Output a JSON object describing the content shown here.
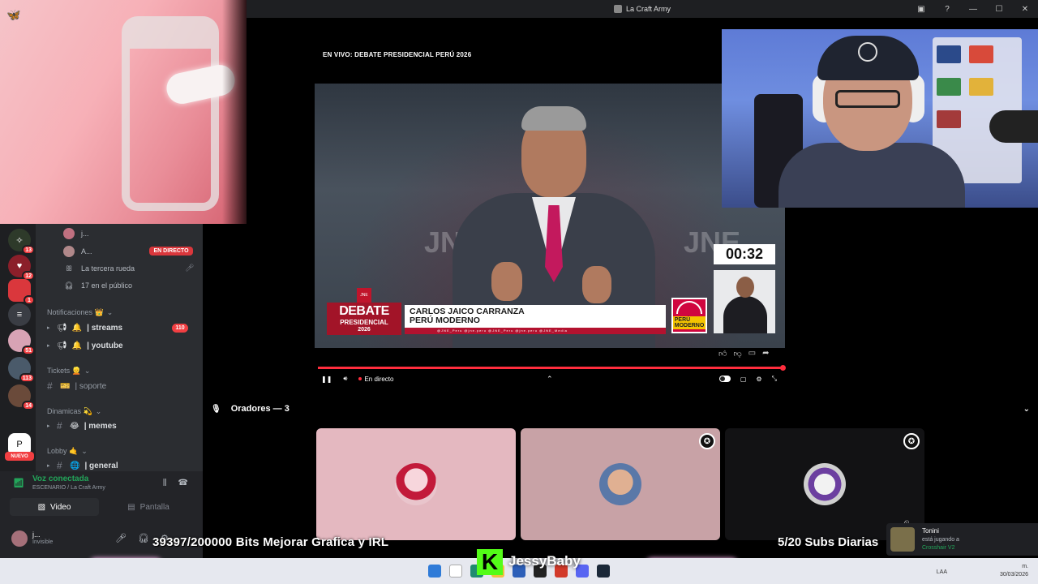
{
  "window": {
    "title": "La Craft Army"
  },
  "broadcast": {
    "title": "EN VIVO: DEBATE PRESIDENCIAL PERÚ 2026",
    "timer": "00:32",
    "watermark_left": "JNE",
    "watermark_right": "JNE",
    "lower_third": {
      "logo_line1": "DEBATE",
      "logo_line2": "PRESIDENCIAL",
      "logo_line3": "2026",
      "jne_badge": "JNE",
      "candidate_name": "CARLOS JAICO CARRANZA",
      "party": "PERÚ MODERNO",
      "party_logo_text": "PERÚ MODERNO",
      "ticker": "@JNE_Peru   @jne.peru   @JNE_Peru   @jne.peru   @JNE_Media"
    },
    "progress_fraction": 1.0,
    "live_label": "En directo"
  },
  "channels": {
    "voice_users": [
      {
        "name": "j..."
      },
      {
        "name": "A..."
      },
      {
        "name": "La tercera rueda"
      },
      {
        "name": "17 en el público"
      }
    ],
    "live_badge": "EN DIRECTO",
    "categories": {
      "notificaciones": "Notificaciones 👑",
      "tickets": "Tickets 👱",
      "dinamicas": "Dinamicas 💫",
      "lobby": "Lobby 🤙"
    },
    "items": {
      "streams": "| streams",
      "streams_count": "110",
      "youtube": "| youtube",
      "soporte": "| soporte",
      "memes": "| memes",
      "general": "| general"
    }
  },
  "servers": {
    "badges": [
      "13",
      "12",
      "1",
      "51",
      "113",
      "14"
    ],
    "nuevo": "NUEVO"
  },
  "voice_panel": {
    "status": "Voz conectada",
    "channel": "ESCENARIO / La Craft Army",
    "video_label": "Video",
    "screen_label": "Pantalla"
  },
  "user_panel": {
    "name": "j...",
    "status": "Invisible"
  },
  "speakers": {
    "header": "Oradores — 3"
  },
  "overlays": {
    "goal": "39397/200000 Bits Mejorar Grafica y IRL",
    "subs": "5/20 Subs Diarias",
    "kick_letter": "K",
    "kick_name": "JessyBaby"
  },
  "notification": {
    "user": "Tonini",
    "line": "está jugando a",
    "game": "Crosshair V2"
  },
  "taskbar": {
    "lang": "LAA",
    "time": "m.",
    "date": "30/03/2026"
  },
  "colors": {
    "accent_red": "#ff2d3d",
    "discord_green": "#23a55a",
    "kick_green": "#53fc18",
    "badge_red": "#f23f42"
  }
}
